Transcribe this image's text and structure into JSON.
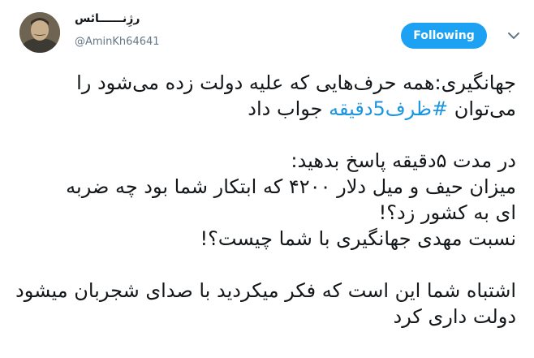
{
  "author": {
    "display_name": "رژِنــــــائس",
    "handle": "@AminKh64641"
  },
  "header": {
    "follow_label": "Following",
    "follow_color": "#1da1f2",
    "menu_icon": "chevron-down-icon"
  },
  "tweet": {
    "line1": "جهانگیری:همه حرف‌هایی که علیه دولت زده می‌شود را",
    "line2_before": "می‌توان ",
    "hashtag": "#ظرف5دقیقه",
    "line2_after": " جواب داد",
    "line3": "در مدت ۵دقیقه پاسخ بدهید:",
    "line4": "میزان حیف و میل دلار ۴۲۰۰ که ابتکار شما بود چه ضربه",
    "line5": "ای به کشور زد؟!",
    "line6": "نسبت مهدی جهانگیری با شما چیست؟!",
    "line7": "اشتباه شما این است که فکر میکردید با صدای شجربان میشود",
    "line8": "دولت داری کرد",
    "hashtag_color": "#1b95e0"
  }
}
